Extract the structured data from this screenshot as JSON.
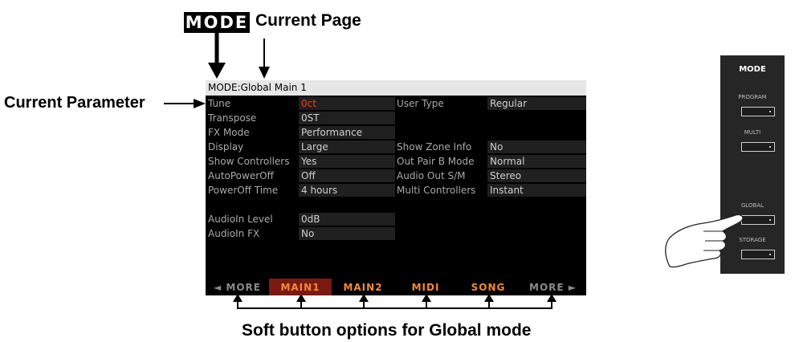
{
  "labels": {
    "mode": "MODE",
    "current_page": "Current Page",
    "current_parameter": "Current Parameter",
    "soft_buttons": "Soft button options for Global mode"
  },
  "screen": {
    "title": "MODE:Global Main 1",
    "params": [
      {
        "label": "Tune",
        "value": "0ct"
      },
      {
        "label": "Transpose",
        "value": "0ST"
      },
      {
        "label": "FX Mode",
        "value": "Performance"
      },
      {
        "label": "Display",
        "value": "Large"
      },
      {
        "label": "Show Controllers",
        "value": "Yes"
      },
      {
        "label": "AutoPowerOff",
        "value": "Off"
      },
      {
        "label": "PowerOff Time",
        "value": "4 hours"
      },
      {
        "label": "AudioIn Level",
        "value": "0dB"
      },
      {
        "label": "AudioIn FX",
        "value": "No"
      }
    ],
    "params_right": [
      {
        "label": "User Type",
        "value": "Regular"
      },
      {
        "label": "Show Zone Info",
        "value": "No"
      },
      {
        "label": "Out Pair B Mode",
        "value": "Normal"
      },
      {
        "label": "Audio Out S/M",
        "value": "Stereo"
      },
      {
        "label": "Multi Controllers",
        "value": "Instant"
      }
    ],
    "soft_buttons": [
      "◄ MORE",
      "MAIN1",
      "MAIN2",
      "MIDI",
      "SONG",
      "MORE ►"
    ]
  },
  "panel": {
    "title": "MODE",
    "buttons": [
      "PROGRAM",
      "MULTI",
      "GLOBAL",
      "STORAGE"
    ]
  },
  "colors": {
    "selected_value": "#e8402a",
    "soft_button_text": "#f08a3c",
    "soft_button_active_bg": "#7a1a12"
  }
}
